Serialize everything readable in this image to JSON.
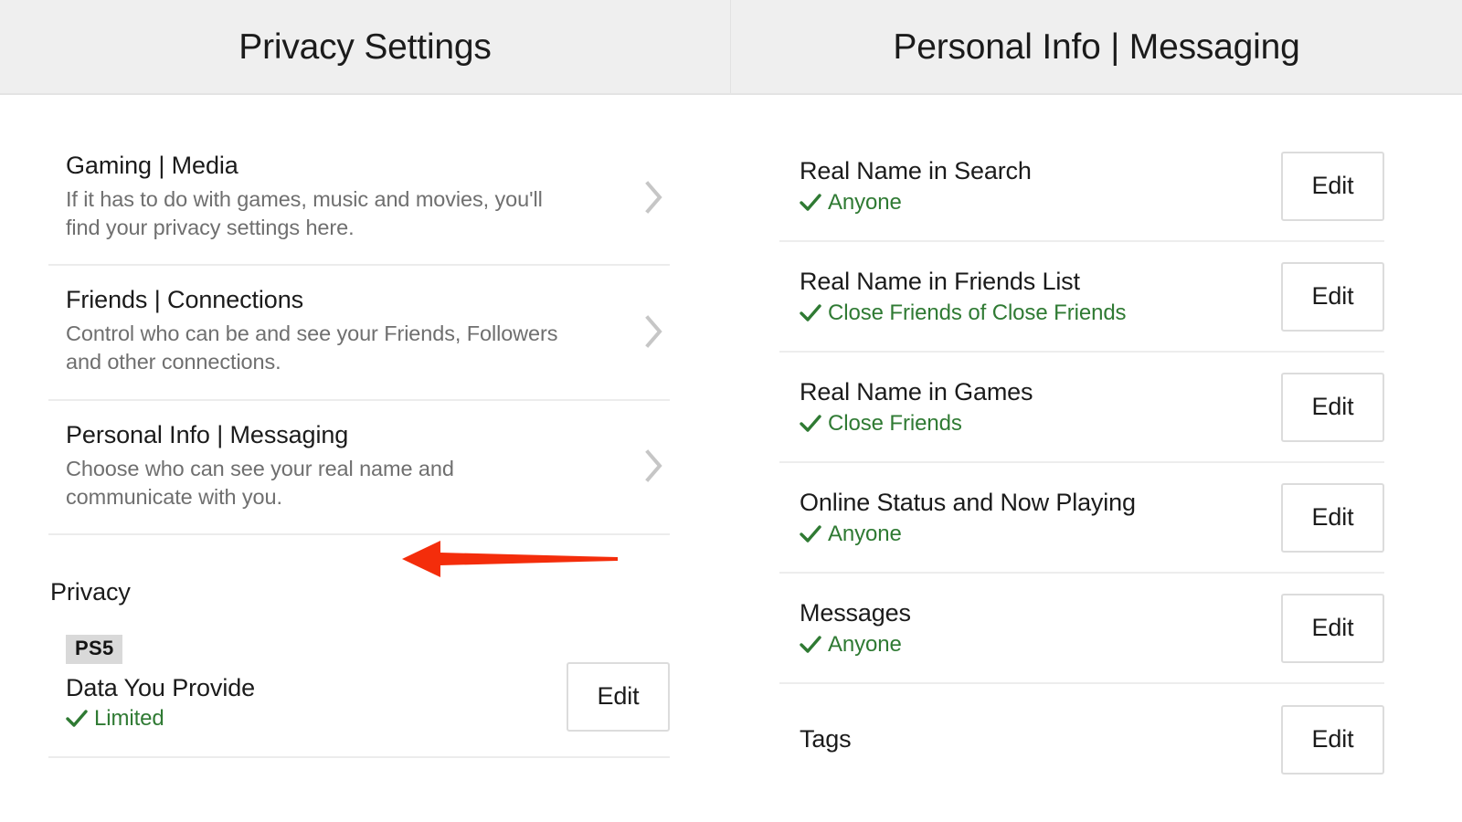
{
  "headers": {
    "left": "Privacy Settings",
    "right": "Personal Info | Messaging"
  },
  "colors": {
    "header_bg": "#efefef",
    "text_primary": "#1b1b1b",
    "text_secondary": "#6f6f6f",
    "value_green": "#2f7a33",
    "divider": "#ececec",
    "badge_bg": "#d9d9d9",
    "arrow_red": "#f42d0b",
    "button_border": "#dcdcdc",
    "chevron": "#c6c6c6"
  },
  "left_panel": {
    "nav_items": [
      {
        "title": "Gaming | Media",
        "description": "If it has to do with games, music and movies, you'll find your privacy settings here.",
        "chevron": "chevron-right-icon"
      },
      {
        "title": "Friends | Connections",
        "description": "Control who can be and see your Friends, Followers and other connections.",
        "chevron": "chevron-right-icon"
      },
      {
        "title": "Personal Info | Messaging",
        "description": "Choose who can see your real name and communicate with you.",
        "chevron": "chevron-right-icon"
      }
    ],
    "section_heading": "Privacy",
    "privacy_rows": [
      {
        "badge": "PS5",
        "name": "Data You Provide",
        "value": "Limited",
        "edit_label": "Edit"
      }
    ]
  },
  "right_panel": {
    "settings": [
      {
        "name": "Real Name in Search",
        "value": "Anyone",
        "edit_label": "Edit"
      },
      {
        "name": "Real Name in Friends List",
        "value": "Close Friends of Close Friends",
        "edit_label": "Edit"
      },
      {
        "name": "Real Name in Games",
        "value": "Close Friends",
        "edit_label": "Edit"
      },
      {
        "name": "Online Status and Now Playing",
        "value": "Anyone",
        "edit_label": "Edit"
      },
      {
        "name": "Messages",
        "value": "Anyone",
        "edit_label": "Edit"
      },
      {
        "name": "Tags",
        "value": "",
        "edit_label": "Edit"
      }
    ]
  },
  "annotations": [
    {
      "name": "arrow-personal-info-messaging",
      "points_to": "Personal Info | Messaging",
      "direction": "left"
    },
    {
      "name": "arrow-online-status-anyone",
      "points_to": "Anyone",
      "direction": "left"
    }
  ]
}
